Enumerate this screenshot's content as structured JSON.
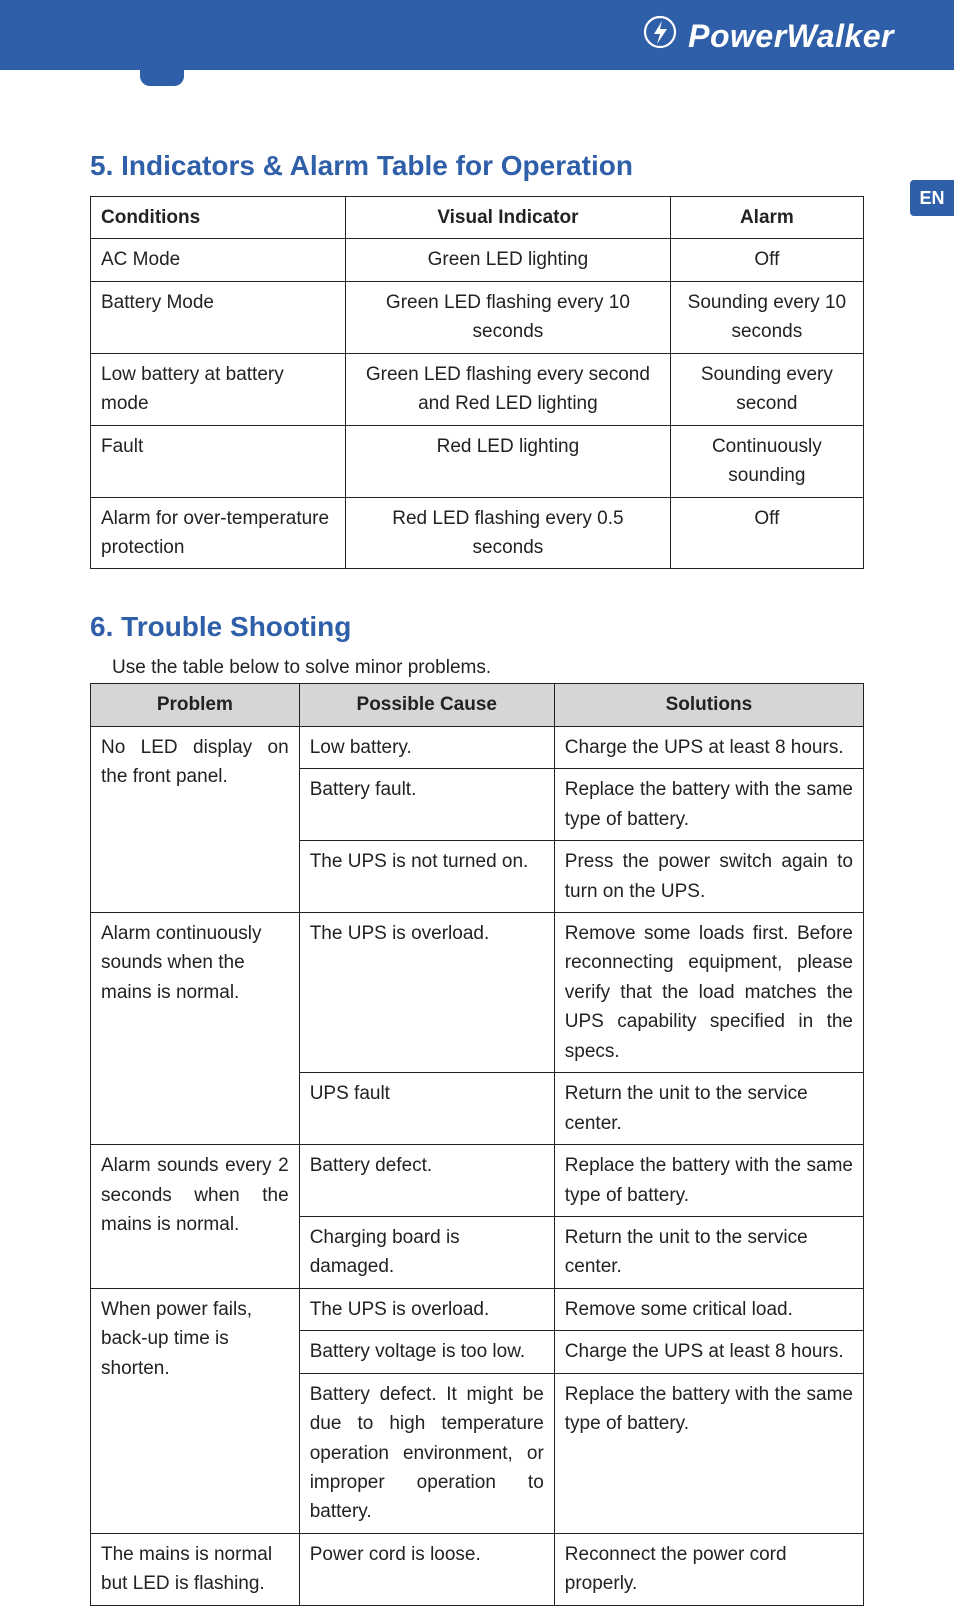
{
  "brand": "PowerWalker",
  "lang_badge": "EN",
  "section5": {
    "title": "5. Indicators & Alarm Table for Operation",
    "headers": {
      "c1": "Conditions",
      "c2": "Visual Indicator",
      "c3": "Alarm"
    },
    "rows": [
      {
        "c1": "AC Mode",
        "c2": "Green LED lighting",
        "c3": "Off"
      },
      {
        "c1": "Battery Mode",
        "c2": "Green LED flashing every 10 seconds",
        "c3": "Sounding every 10 seconds"
      },
      {
        "c1": "Low battery at battery mode",
        "c2": "Green LED flashing every second and Red LED lighting",
        "c3": "Sounding every second"
      },
      {
        "c1": "Fault",
        "c2": "Red LED lighting",
        "c3": "Continuously sounding"
      },
      {
        "c1": "Alarm for over-temperature protection",
        "c2": "Red LED flashing every 0.5 seconds",
        "c3": "Off"
      }
    ]
  },
  "section6": {
    "title": "6. Trouble Shooting",
    "intro": "Use the table below to solve minor problems.",
    "headers": {
      "c1": "Problem",
      "c2": "Possible Cause",
      "c3": "Solutions"
    },
    "groups": [
      {
        "problem": "No LED display on the front panel.",
        "rows": [
          {
            "cause": "Low battery.",
            "solution": "Charge the UPS at least 8 hours."
          },
          {
            "cause": "Battery fault.",
            "solution": "Replace the battery with the same type of battery."
          },
          {
            "cause": "The UPS is not turned on.",
            "solution": "Press the power switch again to turn on the UPS."
          }
        ]
      },
      {
        "problem": "Alarm continuously sounds when the mains is normal.",
        "rows": [
          {
            "cause": "The UPS is overload.",
            "solution": "Remove some loads first. Before reconnecting equipment, please verify that the load matches the UPS capability specified in the specs."
          },
          {
            "cause": "UPS fault",
            "solution": "Return the unit to the service center."
          }
        ]
      },
      {
        "problem": "Alarm sounds every 2 seconds when the mains is normal.",
        "rows": [
          {
            "cause": "Battery defect.",
            "solution": "Replace the battery with the same type of battery."
          },
          {
            "cause": "Charging board is damaged.",
            "solution": "Return the unit to the service center."
          }
        ]
      },
      {
        "problem": "When power fails, back-up time is shorten.",
        "rows": [
          {
            "cause": "The UPS is overload.",
            "solution": "Remove some critical load."
          },
          {
            "cause": "Battery voltage is too low.",
            "solution": "Charge the UPS at least 8 hours."
          },
          {
            "cause": "Battery defect. It might be due to high temperature operation environment, or improper operation to battery.",
            "solution": "Replace the battery with the same type of battery."
          }
        ]
      },
      {
        "problem": "The mains is normal but LED is flashing.",
        "rows": [
          {
            "cause": "Power cord is loose.",
            "solution": "Reconnect the power cord properly."
          }
        ]
      }
    ]
  }
}
